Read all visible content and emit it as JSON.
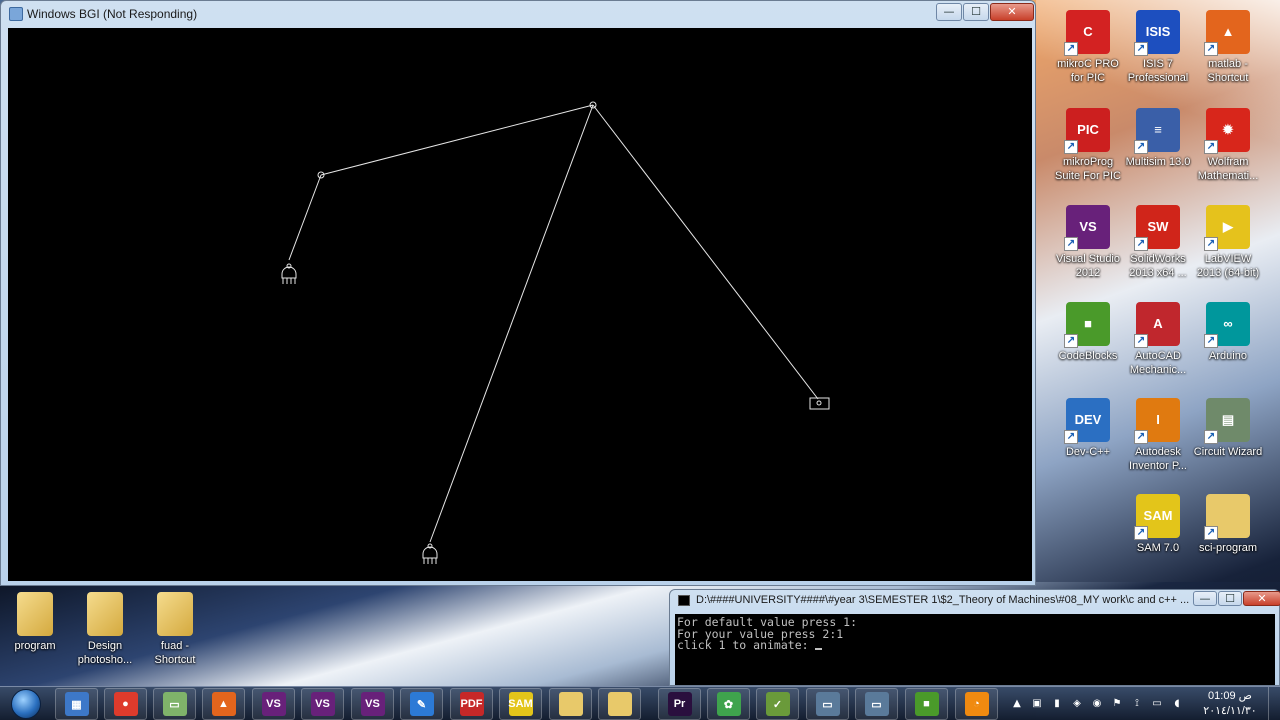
{
  "bgi_window": {
    "title": "Windows BGI (Not Responding)",
    "buttons": {
      "minimize": "—",
      "maximize": "☐",
      "close": "✕"
    }
  },
  "desktop_icons_right": [
    {
      "label": "mikroC PRO for PIC",
      "icon": "mikroc-icon",
      "glyph": "C",
      "color": "#d32222"
    },
    {
      "label": "ISIS 7 Professional",
      "icon": "isis-icon",
      "glyph": "ISIS",
      "color": "#1d4fbf"
    },
    {
      "label": "matlab - Shortcut",
      "icon": "matlab-icon",
      "glyph": "▲",
      "color": "#e3651d"
    },
    {
      "label": "mikroProg Suite For PIC",
      "icon": "mikroprog-icon",
      "glyph": "PIC",
      "color": "#cc1f1f"
    },
    {
      "label": "Multisim 13.0",
      "icon": "multisim-icon",
      "glyph": "≡",
      "color": "#3a5fa8"
    },
    {
      "label": "Wolfram Mathemati...",
      "icon": "wolfram-icon",
      "glyph": "✹",
      "color": "#d8261b"
    },
    {
      "label": "Visual Studio 2012",
      "icon": "visual-studio-icon",
      "glyph": "VS",
      "color": "#68217a"
    },
    {
      "label": "SolidWorks 2013 x64 ...",
      "icon": "solidworks-icon",
      "glyph": "SW",
      "color": "#d0251a"
    },
    {
      "label": "LabVIEW 2013 (64-bit)",
      "icon": "labview-icon",
      "glyph": "▶",
      "color": "#e5c21c"
    },
    {
      "label": "CodeBlocks",
      "icon": "codeblocks-icon",
      "glyph": "■",
      "color": "#4a9a2a"
    },
    {
      "label": "AutoCAD Mechanic...",
      "icon": "autocad-icon",
      "glyph": "A",
      "color": "#c0272d"
    },
    {
      "label": "Arduino",
      "icon": "arduino-icon",
      "glyph": "∞",
      "color": "#00979c"
    },
    {
      "label": "Dev-C++",
      "icon": "devcpp-icon",
      "glyph": "DEV",
      "color": "#2b6fc2"
    },
    {
      "label": "Autodesk Inventor P...",
      "icon": "inventor-icon",
      "glyph": "I",
      "color": "#e07a10"
    },
    {
      "label": "Circuit Wizard",
      "icon": "circuit-wizard-icon",
      "glyph": "▤",
      "color": "#6f8a6a"
    },
    {
      "label": "SAM 7.0",
      "icon": "sam-icon",
      "glyph": "SAM",
      "color": "#e3c51a"
    },
    {
      "label": "sci-program",
      "icon": "folder-icon",
      "glyph": "",
      "color": "#e8c96a"
    }
  ],
  "desktop_icons_bottom": [
    {
      "label": "program",
      "icon": "folder-icon"
    },
    {
      "label": "Design photosho...",
      "icon": "folder-icon"
    },
    {
      "label": "fuad - Shortcut",
      "icon": "folder-icon"
    }
  ],
  "console": {
    "title": "D:\\####UNIVERSITY####\\#year 3\\SEMESTER 1\\$2_Theory of Machines\\#08_MY work\\c  and c++ ...",
    "lines": [
      "For default value press 1:",
      "For your value press 2:1",
      "click 1 to animate: "
    ]
  },
  "taskbar": {
    "items": [
      {
        "icon": "control-panel-icon",
        "glyph": "▦",
        "color": "#3d78c8"
      },
      {
        "icon": "chrome-icon",
        "glyph": "●",
        "color": "#de3b2c"
      },
      {
        "icon": "explorer-icon",
        "glyph": "▭",
        "color": "#7fb36a"
      },
      {
        "icon": "matlab-icon",
        "glyph": "▲",
        "color": "#e3651d"
      },
      {
        "icon": "visual-studio-icon",
        "glyph": "VS",
        "color": "#68217a"
      },
      {
        "icon": "visual-studio-icon",
        "glyph": "VS",
        "color": "#68217a"
      },
      {
        "icon": "visual-studio-icon",
        "glyph": "VS",
        "color": "#68217a"
      },
      {
        "icon": "pencil-app-icon",
        "glyph": "✎",
        "color": "#2c7ad6"
      },
      {
        "icon": "pdf-icon",
        "glyph": "PDF",
        "color": "#c62828"
      },
      {
        "icon": "sam-icon",
        "glyph": "SAM",
        "color": "#e3c51a"
      },
      {
        "icon": "folder-icon",
        "glyph": "",
        "color": "#e8c96a"
      },
      {
        "icon": "folder-icon",
        "glyph": "",
        "color": "#e8c96a"
      },
      {
        "icon": "premiere-icon",
        "glyph": "Pr",
        "color": "#2a0f3e"
      },
      {
        "icon": "parrot-icon",
        "glyph": "✿",
        "color": "#3fa34d"
      },
      {
        "icon": "notepad-icon",
        "glyph": "✓",
        "color": "#6a9a3a"
      },
      {
        "icon": "window-icon",
        "glyph": "▭",
        "color": "#5a7a9a"
      },
      {
        "icon": "window-icon",
        "glyph": "▭",
        "color": "#5a7a9a"
      },
      {
        "icon": "codeblocks-icon",
        "glyph": "■",
        "color": "#4a9a2a"
      },
      {
        "icon": "ie-icon",
        "glyph": "◔",
        "color": "#f08a10"
      }
    ],
    "clock_time": "01:09 ص",
    "clock_date": "٢٠١٤/١١/٣٠"
  }
}
